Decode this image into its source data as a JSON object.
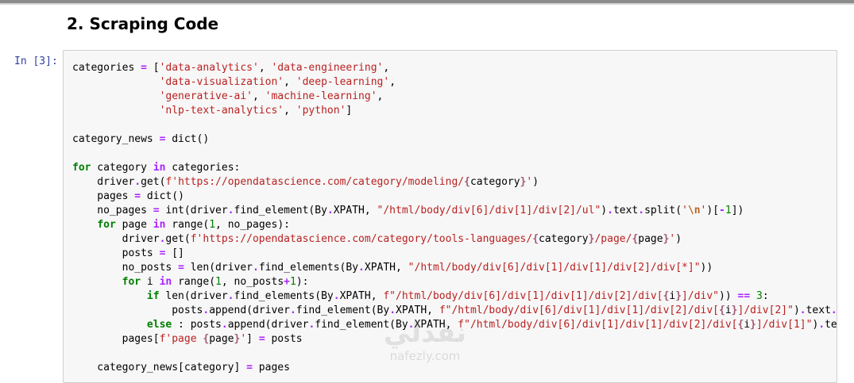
{
  "section_heading": "2. Scraping Code",
  "cell": {
    "prompt": "In [3]:",
    "lines": [
      [
        [
          "t",
          "categories "
        ],
        [
          "op",
          "="
        ],
        [
          "t",
          " ["
        ],
        [
          "str",
          "'data-analytics'"
        ],
        [
          "t",
          ", "
        ],
        [
          "str",
          "'data-engineering'"
        ],
        [
          "t",
          ","
        ]
      ],
      [
        [
          "t",
          "              "
        ],
        [
          "str",
          "'data-visualization'"
        ],
        [
          "t",
          ", "
        ],
        [
          "str",
          "'deep-learning'"
        ],
        [
          "t",
          ","
        ]
      ],
      [
        [
          "t",
          "              "
        ],
        [
          "str",
          "'generative-ai'"
        ],
        [
          "t",
          ", "
        ],
        [
          "str",
          "'machine-learning'"
        ],
        [
          "t",
          ","
        ]
      ],
      [
        [
          "t",
          "              "
        ],
        [
          "str",
          "'nlp-text-analytics'"
        ],
        [
          "t",
          ", "
        ],
        [
          "str",
          "'python'"
        ],
        [
          "t",
          "]"
        ]
      ],
      [],
      [
        [
          "t",
          "category_news "
        ],
        [
          "op",
          "="
        ],
        [
          "t",
          " dict()"
        ]
      ],
      [],
      [
        [
          "kw",
          "for"
        ],
        [
          "t",
          " category "
        ],
        [
          "op",
          "in"
        ],
        [
          "t",
          " categories:"
        ]
      ],
      [
        [
          "t",
          "    driver"
        ],
        [
          "op",
          "."
        ],
        [
          "t",
          "get("
        ],
        [
          "str",
          "f'https://opendatascience.com/category/modeling/"
        ],
        [
          "int",
          "{"
        ],
        [
          "t",
          "category"
        ],
        [
          "int",
          "}"
        ],
        [
          "str",
          "'"
        ],
        [
          "t",
          ")"
        ]
      ],
      [
        [
          "t",
          "    pages "
        ],
        [
          "op",
          "="
        ],
        [
          "t",
          " dict()"
        ]
      ],
      [
        [
          "t",
          "    no_pages "
        ],
        [
          "op",
          "="
        ],
        [
          "t",
          " int(driver"
        ],
        [
          "op",
          "."
        ],
        [
          "t",
          "find_element(By"
        ],
        [
          "op",
          "."
        ],
        [
          "t",
          "XPATH, "
        ],
        [
          "str",
          "\"/html/body/div[6]/div[1]/div[2]/ul\""
        ],
        [
          "t",
          ")"
        ],
        [
          "op",
          "."
        ],
        [
          "t",
          "text"
        ],
        [
          "op",
          "."
        ],
        [
          "t",
          "split("
        ],
        [
          "str",
          "'"
        ],
        [
          "esc",
          "\\n"
        ],
        [
          "str",
          "'"
        ],
        [
          "t",
          ")["
        ],
        [
          "op",
          "-"
        ],
        [
          "num",
          "1"
        ],
        [
          "t",
          "])"
        ]
      ],
      [
        [
          "t",
          "    "
        ],
        [
          "kw",
          "for"
        ],
        [
          "t",
          " page "
        ],
        [
          "op",
          "in"
        ],
        [
          "t",
          " range("
        ],
        [
          "num",
          "1"
        ],
        [
          "t",
          ", no_pages):"
        ]
      ],
      [
        [
          "t",
          "        driver"
        ],
        [
          "op",
          "."
        ],
        [
          "t",
          "get("
        ],
        [
          "str",
          "f'https://opendatascience.com/category/tools-languages/"
        ],
        [
          "int",
          "{"
        ],
        [
          "t",
          "category"
        ],
        [
          "int",
          "}"
        ],
        [
          "str",
          "/page/"
        ],
        [
          "int",
          "{"
        ],
        [
          "t",
          "page"
        ],
        [
          "int",
          "}"
        ],
        [
          "str",
          "'"
        ],
        [
          "t",
          ")"
        ]
      ],
      [
        [
          "t",
          "        posts "
        ],
        [
          "op",
          "="
        ],
        [
          "t",
          " []"
        ]
      ],
      [
        [
          "t",
          "        no_posts "
        ],
        [
          "op",
          "="
        ],
        [
          "t",
          " len(driver"
        ],
        [
          "op",
          "."
        ],
        [
          "t",
          "find_elements(By"
        ],
        [
          "op",
          "."
        ],
        [
          "t",
          "XPATH, "
        ],
        [
          "str",
          "\"/html/body/div[6]/div[1]/div[1]/div[2]/div[*]\""
        ],
        [
          "t",
          "))"
        ]
      ],
      [
        [
          "t",
          "        "
        ],
        [
          "kw",
          "for"
        ],
        [
          "t",
          " i "
        ],
        [
          "op",
          "in"
        ],
        [
          "t",
          " range("
        ],
        [
          "num",
          "1"
        ],
        [
          "t",
          ", no_posts"
        ],
        [
          "op",
          "+"
        ],
        [
          "num",
          "1"
        ],
        [
          "t",
          "):"
        ]
      ],
      [
        [
          "t",
          "            "
        ],
        [
          "kw",
          "if"
        ],
        [
          "t",
          " len(driver"
        ],
        [
          "op",
          "."
        ],
        [
          "t",
          "find_elements(By"
        ],
        [
          "op",
          "."
        ],
        [
          "t",
          "XPATH, "
        ],
        [
          "str",
          "f\"/html/body/div[6]/div[1]/div[1]/div[2]/div["
        ],
        [
          "int",
          "{"
        ],
        [
          "t",
          "i"
        ],
        [
          "int",
          "}"
        ],
        [
          "str",
          "]/div\""
        ],
        [
          "t",
          ")) "
        ],
        [
          "op",
          "=="
        ],
        [
          "t",
          " "
        ],
        [
          "num",
          "3"
        ],
        [
          "t",
          ":"
        ]
      ],
      [
        [
          "t",
          "                posts"
        ],
        [
          "op",
          "."
        ],
        [
          "t",
          "append(driver"
        ],
        [
          "op",
          "."
        ],
        [
          "t",
          "find_element(By"
        ],
        [
          "op",
          "."
        ],
        [
          "t",
          "XPATH, "
        ],
        [
          "str",
          "f\"/html/body/div[6]/div[1]/div[1]/div[2]/div["
        ],
        [
          "int",
          "{"
        ],
        [
          "t",
          "i"
        ],
        [
          "int",
          "}"
        ],
        [
          "str",
          "]/div[2]\""
        ],
        [
          "t",
          ")"
        ],
        [
          "op",
          "."
        ],
        [
          "t",
          "text"
        ],
        [
          "op",
          "."
        ],
        [
          "t",
          "s"
        ]
      ],
      [
        [
          "t",
          "            "
        ],
        [
          "kw",
          "else"
        ],
        [
          "t",
          " : posts"
        ],
        [
          "op",
          "."
        ],
        [
          "t",
          "append(driver"
        ],
        [
          "op",
          "."
        ],
        [
          "t",
          "find_element(By"
        ],
        [
          "op",
          "."
        ],
        [
          "t",
          "XPATH, "
        ],
        [
          "str",
          "f\"/html/body/div[6]/div[1]/div[1]/div[2]/div["
        ],
        [
          "int",
          "{"
        ],
        [
          "t",
          "i"
        ],
        [
          "int",
          "}"
        ],
        [
          "str",
          "]/div[1]\""
        ],
        [
          "t",
          ")"
        ],
        [
          "op",
          "."
        ],
        [
          "t",
          "tex"
        ]
      ],
      [
        [
          "t",
          "        pages["
        ],
        [
          "str",
          "f'page "
        ],
        [
          "int",
          "{"
        ],
        [
          "t",
          "page"
        ],
        [
          "int",
          "}"
        ],
        [
          "str",
          "'"
        ],
        [
          "t",
          "] "
        ],
        [
          "op",
          "="
        ],
        [
          "t",
          " posts"
        ]
      ],
      [],
      [
        [
          "t",
          "    category_news[category] "
        ],
        [
          "op",
          "="
        ],
        [
          "t",
          " pages"
        ]
      ]
    ]
  },
  "watermark": {
    "mark": "نفذلي",
    "text": "nafezly.com"
  }
}
